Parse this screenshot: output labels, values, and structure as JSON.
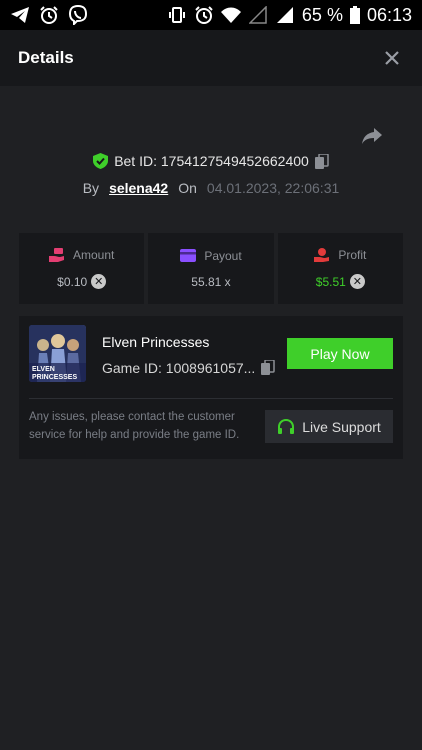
{
  "status_bar": {
    "battery_percent": "65 %",
    "time": "06:13",
    "left_icons": [
      "telegram-icon",
      "alarm-icon",
      "viber-icon"
    ],
    "right_icons": [
      "vibrate-icon",
      "alarm-icon",
      "wifi-icon",
      "signal-icon",
      "signal-icon",
      "battery-icon"
    ]
  },
  "header": {
    "title": "Details"
  },
  "bet": {
    "id_label": "Bet ID: 1754127549452662400",
    "by_label": "By",
    "username": "selena42",
    "on_label": "On",
    "date": "04.01.2023, 22:06:31"
  },
  "stats": [
    {
      "label": "Amount",
      "value": "$0.10",
      "icon": "money-hand-icon",
      "color": "#e33e72"
    },
    {
      "label": "Payout",
      "value": "55.81 x",
      "icon": "card-icon",
      "color": "#8a4fff"
    },
    {
      "label": "Profit",
      "value": "$5.51",
      "icon": "profit-icon",
      "color": "#e23b3b"
    }
  ],
  "game": {
    "name": "Elven Princesses",
    "id": "Game ID: 1008961057...",
    "play_label": "Play Now",
    "thumb_text_1": "ELVEN",
    "thumb_text_2": "PRINCESSES"
  },
  "support": {
    "text": "Any issues, please contact the customer service for help and provide the game ID.",
    "button_label": "Live Support"
  },
  "colors": {
    "accent": "#3fcf2a",
    "background": "#1f2023",
    "panel": "#17181b"
  }
}
